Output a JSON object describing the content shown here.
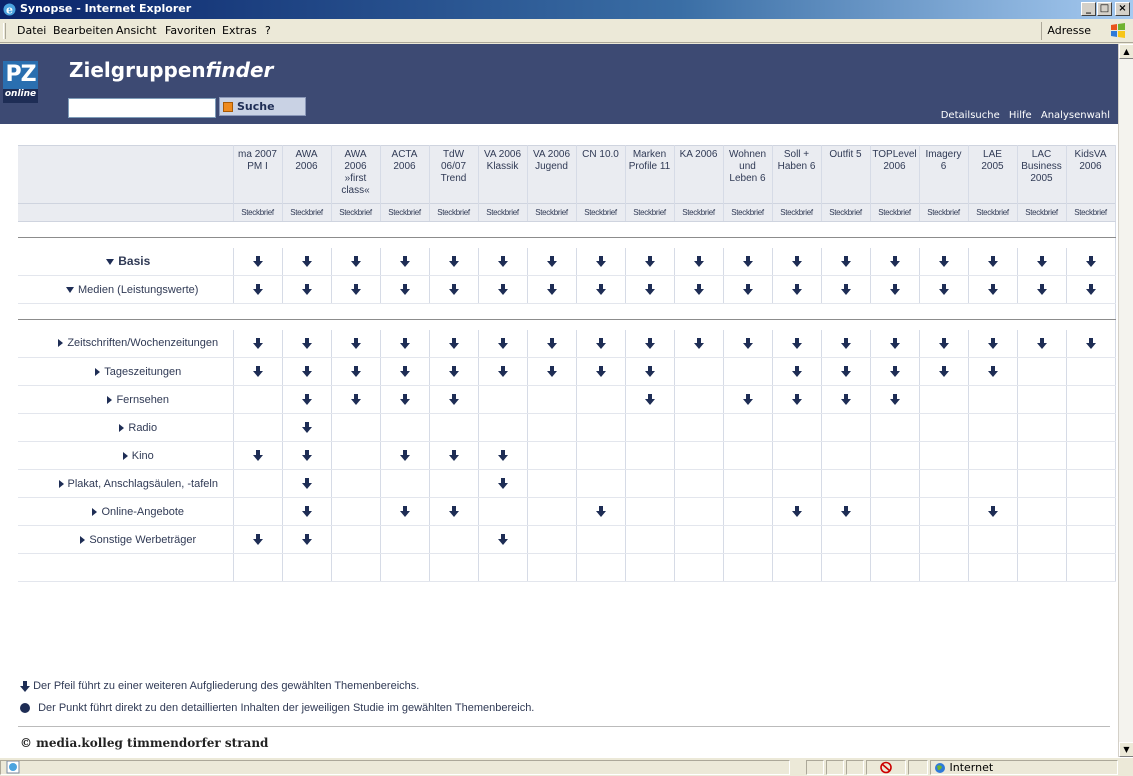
{
  "window": {
    "title": "Synopse - Internet Explorer"
  },
  "menu": [
    "Datei",
    "Bearbeiten",
    "Ansicht",
    "Favoriten",
    "Extras",
    "?"
  ],
  "address_label": "Adresse",
  "header": {
    "logo_pz": "PZ",
    "logo_online": "online",
    "title_regular": "Zielgruppen",
    "title_italic": "finder",
    "search_button": "Suche",
    "search_value": "",
    "links": [
      "Detailsuche",
      "Hilfe",
      "Analysenwahl"
    ]
  },
  "columns": [
    [
      "ma 2007",
      "PM I"
    ],
    [
      "AWA",
      "2006"
    ],
    [
      "AWA",
      "2006",
      "»first",
      "class«"
    ],
    [
      "ACTA",
      "2006"
    ],
    [
      "TdW",
      "06/07",
      "Trend"
    ],
    [
      "VA 2006",
      "Klassik"
    ],
    [
      "VA 2006",
      "Jugend"
    ],
    [
      "CN 10.0"
    ],
    [
      "Marken",
      "Profile 11"
    ],
    [
      "KA 2006"
    ],
    [
      "Wohnen",
      "und",
      "Leben 6"
    ],
    [
      "Soll +",
      "Haben 6"
    ],
    [
      "Outfit 5"
    ],
    [
      "TOPLevel",
      "2006"
    ],
    [
      "Imagery",
      "6"
    ],
    [
      "LAE",
      "2005"
    ],
    [
      "LAC",
      "Business",
      "2005"
    ],
    [
      "KidsVA",
      "2006"
    ]
  ],
  "steckbrief_label": "Steckbrief",
  "rows_top": [
    {
      "label": "Basis",
      "style": "basis",
      "tri": "down",
      "marks": [
        1,
        1,
        1,
        1,
        1,
        1,
        1,
        1,
        1,
        1,
        1,
        1,
        1,
        1,
        1,
        1,
        1,
        1
      ]
    },
    {
      "label": "Medien (Leistungswerte)",
      "style": "sub",
      "tri": "down",
      "marks": [
        1,
        1,
        1,
        1,
        1,
        1,
        1,
        1,
        1,
        1,
        1,
        1,
        1,
        1,
        1,
        1,
        1,
        1
      ]
    }
  ],
  "rows_media": [
    {
      "label": "Zeitschriften/Wochenzeitungen",
      "marks": [
        1,
        1,
        1,
        1,
        1,
        1,
        1,
        1,
        1,
        1,
        1,
        1,
        1,
        1,
        1,
        1,
        1,
        1
      ]
    },
    {
      "label": "Tageszeitungen",
      "marks": [
        1,
        1,
        1,
        1,
        1,
        1,
        1,
        1,
        1,
        0,
        0,
        1,
        1,
        1,
        1,
        1,
        0,
        0
      ]
    },
    {
      "label": "Fernsehen",
      "marks": [
        0,
        1,
        1,
        1,
        1,
        0,
        0,
        0,
        1,
        0,
        1,
        1,
        1,
        1,
        0,
        0,
        0,
        0
      ]
    },
    {
      "label": "Radio",
      "marks": [
        0,
        1,
        0,
        0,
        0,
        0,
        0,
        0,
        0,
        0,
        0,
        0,
        0,
        0,
        0,
        0,
        0,
        0
      ]
    },
    {
      "label": "Kino",
      "marks": [
        1,
        1,
        0,
        1,
        1,
        1,
        0,
        0,
        0,
        0,
        0,
        0,
        0,
        0,
        0,
        0,
        0,
        0
      ]
    },
    {
      "label": "Plakat, Anschlagsäulen, -tafeln",
      "marks": [
        0,
        1,
        0,
        0,
        0,
        1,
        0,
        0,
        0,
        0,
        0,
        0,
        0,
        0,
        0,
        0,
        0,
        0
      ]
    },
    {
      "label": "Online-Angebote",
      "marks": [
        0,
        1,
        0,
        1,
        1,
        0,
        0,
        1,
        0,
        0,
        0,
        1,
        1,
        0,
        0,
        1,
        0,
        0
      ]
    },
    {
      "label": "Sonstige Werbeträger",
      "marks": [
        1,
        1,
        0,
        0,
        0,
        1,
        0,
        0,
        0,
        0,
        0,
        0,
        0,
        0,
        0,
        0,
        0,
        0
      ]
    }
  ],
  "legend": {
    "arrow_text": "Der Pfeil führt zu einer weiteren Aufgliederung des gewählten Themenbereichs.",
    "dot_text": "Der Punkt führt direkt zu den detaillierten Inhalten der jeweiligen Studie im gewählten Themenbereich."
  },
  "footer": "© media.kolleg timmendorfer strand",
  "status": {
    "zone": "Internet"
  },
  "colors": {
    "header_bg": "#3d4a73",
    "arrow": "#1e2d55",
    "accent": "#ee8a1e"
  }
}
